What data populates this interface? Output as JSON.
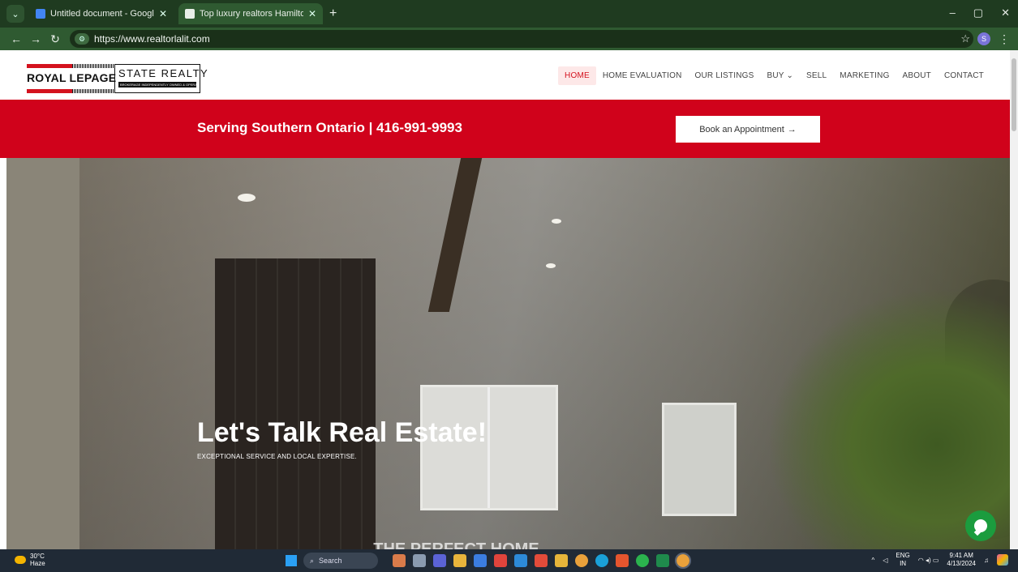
{
  "browser": {
    "tabs": [
      {
        "title": "Untitled document - Google Do",
        "favicon_color": "#4285f4",
        "active": false
      },
      {
        "title": "Top luxury realtors Hamilton | R",
        "favicon_color": "#e8eee8",
        "active": true
      }
    ],
    "url": "https://www.realtorlalit.com",
    "profile_initial": "S"
  },
  "site": {
    "logo": {
      "royal": "ROYAL LEPAGE",
      "state": "STATE REALTY",
      "sub": "BROKERAGE INDEPENDENTLY OWNED & OPERATED"
    },
    "menu": [
      {
        "label": "HOME",
        "active": true
      },
      {
        "label": "HOME EVALUATION",
        "active": false
      },
      {
        "label": "OUR LISTINGS",
        "active": false
      },
      {
        "label": "BUY ⌄",
        "active": false
      },
      {
        "label": "SELL",
        "active": false
      },
      {
        "label": "MARKETING",
        "active": false
      },
      {
        "label": "ABOUT",
        "active": false
      },
      {
        "label": "CONTACT",
        "active": false
      }
    ],
    "banner": {
      "serving": "Serving Southern Ontario | 416-991-9993",
      "book_label": "Book an Appointment",
      "book_arrow": "→"
    },
    "hero": {
      "title": "Let's Talk Real Estate!",
      "subtitle": "EXCEPTIONAL SERVICE AND LOCAL EXPERTISE.",
      "partial": "... THE PERFECT HOME"
    },
    "colors": {
      "brand_red": "#d0021b",
      "chat_green": "#1b9c3e"
    }
  },
  "taskbar": {
    "weather_temp": "30°C",
    "weather_desc": "Haze",
    "search_label": "Search",
    "lang": "ENG",
    "region": "IN",
    "time": "9:41 AM",
    "date": "4/13/2024"
  }
}
